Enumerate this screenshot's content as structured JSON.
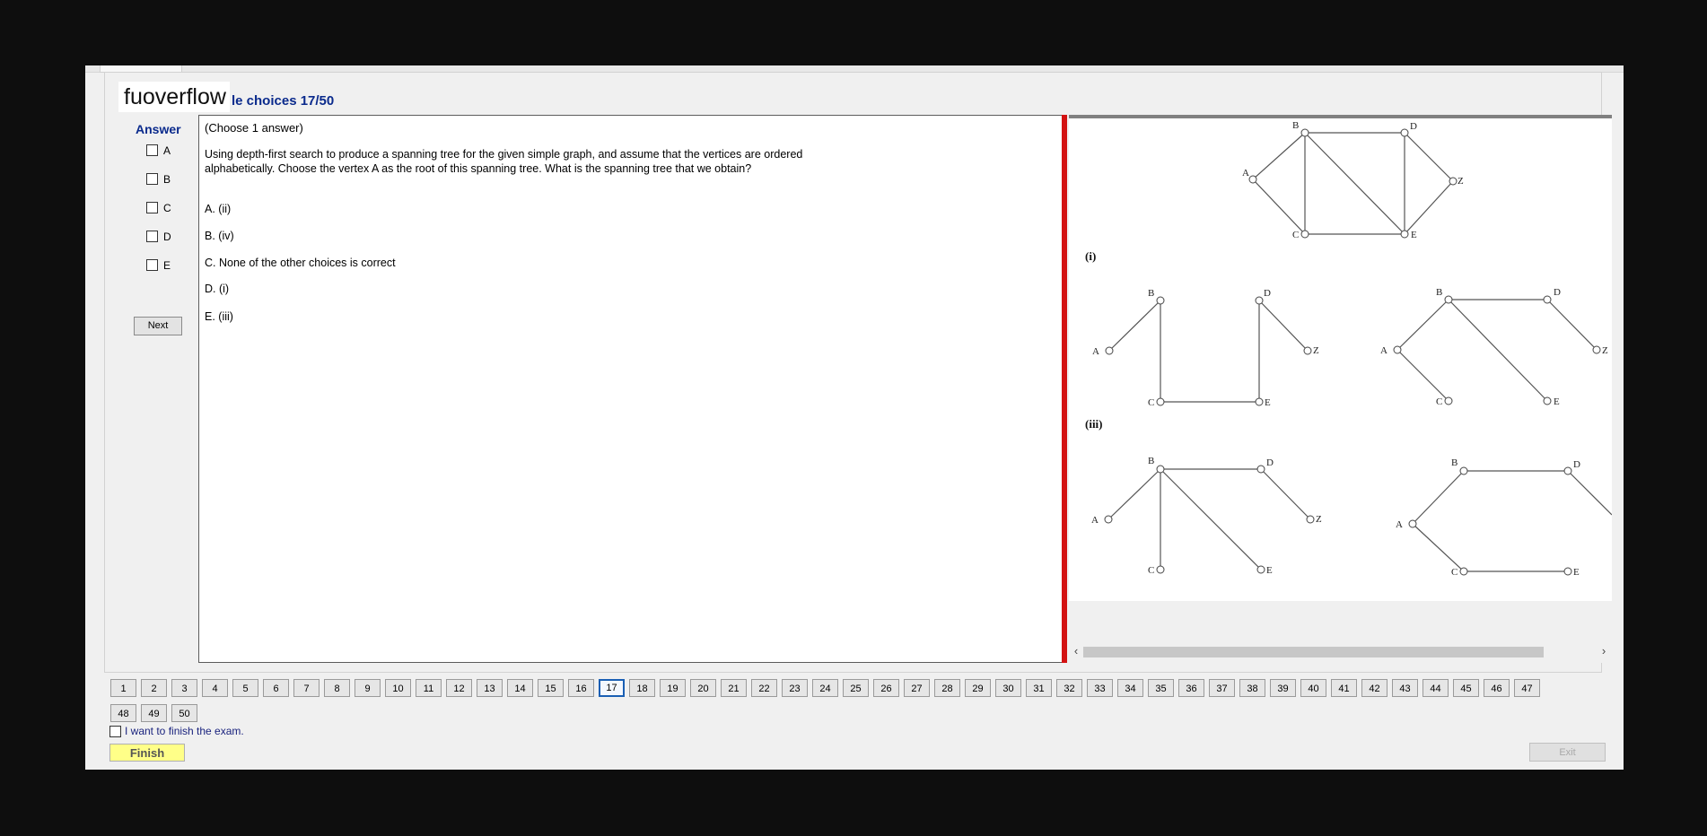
{
  "brand": "fuoverflow",
  "title": "le choices 17/50",
  "answer_panel": {
    "heading": "Answer",
    "options": [
      "A",
      "B",
      "C",
      "D",
      "E"
    ],
    "next_label": "Next"
  },
  "question": {
    "instruction": "(Choose 1 answer)",
    "text": "Using depth-first search to produce a spanning tree for the given simple graph, and assume that the vertices are ordered alphabetically. Choose the vertex A as the root of this spanning tree. What is the spanning tree that we obtain?",
    "choices": [
      "A.  (ii)",
      "B.  (iv)",
      "C.  None of the other choices is correct",
      "D.  (i)",
      "E.  (iii)"
    ]
  },
  "figure": {
    "vertex_labels": [
      "A",
      "B",
      "C",
      "D",
      "E",
      "Z"
    ],
    "tree_labels": [
      "(i)",
      "(iii)"
    ]
  },
  "pagination": {
    "pages": [
      "1",
      "2",
      "3",
      "4",
      "5",
      "6",
      "7",
      "8",
      "9",
      "10",
      "11",
      "12",
      "13",
      "14",
      "15",
      "16",
      "17",
      "18",
      "19",
      "20",
      "21",
      "22",
      "23",
      "24",
      "25",
      "26",
      "27",
      "28",
      "29",
      "30",
      "31",
      "32",
      "33",
      "34",
      "35",
      "36",
      "37",
      "38",
      "39",
      "40",
      "41",
      "42",
      "43",
      "44",
      "45",
      "46",
      "47",
      "48",
      "49",
      "50"
    ],
    "current": "17"
  },
  "finish": {
    "checkbox_label": "I want to finish the exam.",
    "finish_label": "Finish",
    "exit_label": "Exit"
  },
  "colors": {
    "accent_title": "#0a2a8c",
    "divider": "#d31212",
    "finish_button": "#ffff88",
    "current_page_border": "#1a5fb4"
  }
}
